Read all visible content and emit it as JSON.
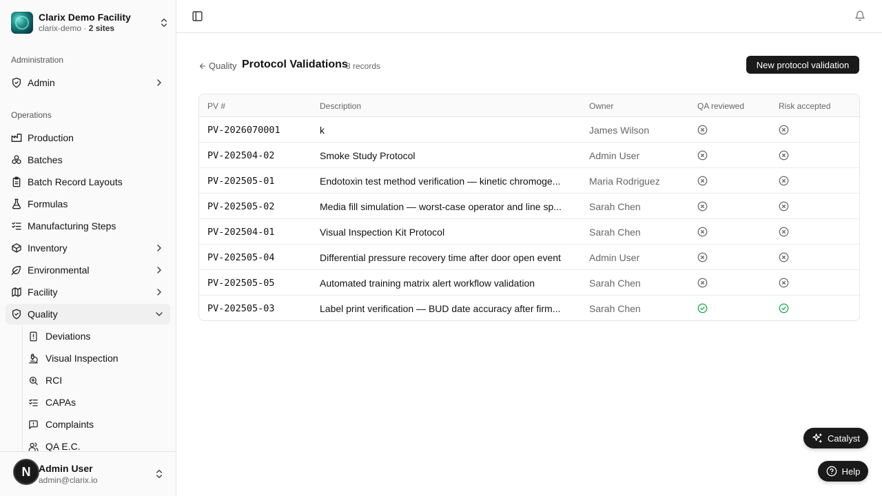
{
  "org": {
    "name": "Clarix Demo Facility",
    "slug": "clarix-demo",
    "sites": "2 sites"
  },
  "sidebar": {
    "sections": {
      "administration": "Administration",
      "operations": "Operations"
    },
    "admin_item": "Admin",
    "items": [
      {
        "label": "Production",
        "icon": "factory-icon"
      },
      {
        "label": "Batches",
        "icon": "boxes-icon"
      },
      {
        "label": "Batch Record Layouts",
        "icon": "clipboard-icon"
      },
      {
        "label": "Formulas",
        "icon": "flask-icon"
      },
      {
        "label": "Manufacturing Steps",
        "icon": "list-checks-icon"
      },
      {
        "label": "Inventory",
        "icon": "box-icon"
      },
      {
        "label": "Environmental",
        "icon": "leaf-icon"
      },
      {
        "label": "Facility",
        "icon": "map-icon"
      },
      {
        "label": "Quality",
        "icon": "shield-check-icon"
      }
    ],
    "quality_sub": [
      {
        "label": "Deviations",
        "icon": "file-alert-icon"
      },
      {
        "label": "Visual Inspection",
        "icon": "microscope-icon"
      },
      {
        "label": "RCI",
        "icon": "search-zoom-icon"
      },
      {
        "label": "CAPAs",
        "icon": "list-checks-icon"
      },
      {
        "label": "Complaints",
        "icon": "message-alert-icon"
      },
      {
        "label": "QA E.C.",
        "icon": "users-icon"
      }
    ]
  },
  "user": {
    "initial": "N",
    "name": "Admin User",
    "email": "admin@clarix.io"
  },
  "page": {
    "back_label": "Quality",
    "title": "Protocol Validations",
    "record_count": "8 records",
    "new_button": "New protocol validation"
  },
  "table": {
    "headers": {
      "pv": "PV #",
      "description": "Description",
      "owner": "Owner",
      "qa": "QA reviewed",
      "risk": "Risk accepted"
    },
    "rows": [
      {
        "pv": "PV-2026070001",
        "description": "k",
        "owner": "James Wilson",
        "qa": false,
        "risk": false
      },
      {
        "pv": "PV-202504-02",
        "description": "Smoke Study Protocol",
        "owner": "Admin User",
        "qa": false,
        "risk": false
      },
      {
        "pv": "PV-202505-01",
        "description": "Endotoxin test method verification — kinetic chromoge...",
        "owner": "Maria Rodriguez",
        "qa": false,
        "risk": false
      },
      {
        "pv": "PV-202505-02",
        "description": "Media fill simulation — worst-case operator and line sp...",
        "owner": "Sarah Chen",
        "qa": false,
        "risk": false
      },
      {
        "pv": "PV-202504-01",
        "description": "Visual Inspection Kit Protocol",
        "owner": "Sarah Chen",
        "qa": false,
        "risk": false
      },
      {
        "pv": "PV-202505-04",
        "description": "Differential pressure recovery time after door open event",
        "owner": "Admin User",
        "qa": false,
        "risk": false
      },
      {
        "pv": "PV-202505-05",
        "description": "Automated training matrix alert workflow validation",
        "owner": "Sarah Chen",
        "qa": false,
        "risk": false
      },
      {
        "pv": "PV-202505-03",
        "description": "Label print verification — BUD date accuracy after firm...",
        "owner": "Sarah Chen",
        "qa": true,
        "risk": true
      }
    ]
  },
  "floating": {
    "catalyst": "Catalyst",
    "help": "Help"
  },
  "colors": {
    "accent_dark": "#1a1a1a",
    "status_ok": "#16a34a",
    "status_no": "#666666"
  }
}
